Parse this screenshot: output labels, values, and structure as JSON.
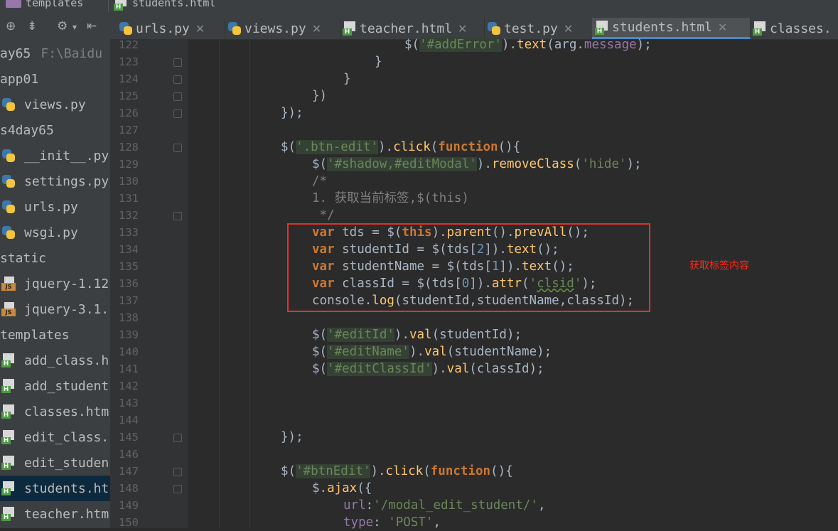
{
  "nav": {
    "folder": "templates",
    "file": "students.html"
  },
  "sidebar": {
    "toolbar": [
      "target",
      "collapse",
      "settings",
      "hide"
    ],
    "items": [
      {
        "label": "ay65",
        "hint": "F:\\Baidu",
        "icon": "none",
        "indent": 0
      },
      {
        "label": "app01",
        "hint": "",
        "icon": "none",
        "indent": 0
      },
      {
        "label": "views.py",
        "hint": "",
        "icon": "python",
        "indent": 1
      },
      {
        "label": "s4day65",
        "hint": "",
        "icon": "none",
        "indent": 0
      },
      {
        "label": "__init__.py",
        "hint": "",
        "icon": "python",
        "indent": 1
      },
      {
        "label": "settings.py",
        "hint": "",
        "icon": "python",
        "indent": 1
      },
      {
        "label": "urls.py",
        "hint": "",
        "icon": "python",
        "indent": 1
      },
      {
        "label": "wsgi.py",
        "hint": "",
        "icon": "python",
        "indent": 1
      },
      {
        "label": "static",
        "hint": "",
        "icon": "none",
        "indent": 0
      },
      {
        "label": "jquery-1.12",
        "hint": "",
        "icon": "js",
        "indent": 1
      },
      {
        "label": "jquery-3.1.",
        "hint": "",
        "icon": "js",
        "indent": 1
      },
      {
        "label": "templates",
        "hint": "",
        "icon": "none",
        "indent": 0
      },
      {
        "label": "add_class.h",
        "hint": "",
        "icon": "html",
        "indent": 1
      },
      {
        "label": "add_student",
        "hint": "",
        "icon": "html",
        "indent": 1
      },
      {
        "label": "classes.htm",
        "hint": "",
        "icon": "html",
        "indent": 1
      },
      {
        "label": "edit_class.",
        "hint": "",
        "icon": "html",
        "indent": 1
      },
      {
        "label": "edit_studen",
        "hint": "",
        "icon": "html",
        "indent": 1
      },
      {
        "label": "students.ht",
        "hint": "",
        "icon": "html",
        "indent": 1,
        "selected": true
      },
      {
        "label": "teacher.htm",
        "hint": "",
        "icon": "html",
        "indent": 1
      }
    ]
  },
  "tabs": [
    {
      "label": "urls.py",
      "icon": "python",
      "active": false
    },
    {
      "label": "views.py",
      "icon": "python",
      "active": false
    },
    {
      "label": "teacher.html",
      "icon": "html",
      "active": false
    },
    {
      "label": "test.py",
      "icon": "python",
      "active": false
    },
    {
      "label": "students.html",
      "icon": "html",
      "active": true
    },
    {
      "label": "classes.",
      "icon": "html",
      "active": false
    }
  ],
  "line_numbers": [
    "122",
    "123",
    "124",
    "125",
    "126",
    "127",
    "128",
    "129",
    "130",
    "131",
    "132",
    "133",
    "134",
    "135",
    "136",
    "137",
    "138",
    "139",
    "140",
    "141",
    "142",
    "143",
    "144",
    "145",
    "146",
    "147",
    "148",
    "149",
    "150"
  ],
  "code": {
    "l122_a": "$(",
    "l122_b": "'#addError'",
    "l122_c": ").",
    "l122_d": "text",
    "l122_e": "(arg.",
    "l122_f": "message",
    "l122_g": ");",
    "l123": "}",
    "l124": "}",
    "l125": "})",
    "l126": "});",
    "l128_a": "$(",
    "l128_b": "'.btn-edit'",
    "l128_c": ").",
    "l128_d": "click",
    "l128_e": "(",
    "l128_f": "function",
    "l128_g": "(){",
    "l129_a": "$(",
    "l129_b": "'#shadow,#editModal'",
    "l129_c": ").",
    "l129_d": "removeClass",
    "l129_e": "(",
    "l129_f": "'hide'",
    "l129_g": ");",
    "l130": "/*",
    "l131": "1. 获取当前标签,$(this)",
    "l132": " */",
    "l133_a": "var",
    "l133_b": " tds = $(",
    "l133_c": "this",
    "l133_d": ").",
    "l133_e": "parent",
    "l133_f": "().",
    "l133_g": "prevAll",
    "l133_h": "();",
    "l134_a": "var",
    "l134_b": " studentId = $(tds[",
    "l134_c": "2",
    "l134_d": "]).",
    "l134_e": "text",
    "l134_f": "();",
    "l135_a": "var",
    "l135_b": " studentName = $(tds[",
    "l135_c": "1",
    "l135_d": "]).",
    "l135_e": "text",
    "l135_f": "();",
    "l136_a": "var",
    "l136_b": " classId = $(tds[",
    "l136_c": "0",
    "l136_d": "]).",
    "l136_e": "attr",
    "l136_f": "(",
    "l136_g": "'",
    "l136_h": "clsid",
    "l136_i": "'",
    "l136_j": ");",
    "l137_a": "console.",
    "l137_b": "log",
    "l137_c": "(studentId,studentName,classId);",
    "l139_a": "$(",
    "l139_b": "'#editId'",
    "l139_c": ").",
    "l139_d": "val",
    "l139_e": "(studentId);",
    "l140_a": "$(",
    "l140_b": "'#editName'",
    "l140_c": ").",
    "l140_d": "val",
    "l140_e": "(studentName);",
    "l141_a": "$(",
    "l141_b": "'#editClassId'",
    "l141_c": ").",
    "l141_d": "val",
    "l141_e": "(classId);",
    "l145": "});",
    "l147_a": "$(",
    "l147_b": "'#btnEdit'",
    "l147_c": ").",
    "l147_d": "click",
    "l147_e": "(",
    "l147_f": "function",
    "l147_g": "(){",
    "l148_a": "$.",
    "l148_b": "ajax",
    "l148_c": "({",
    "l149_a": "url",
    "l149_b": ":",
    "l149_c": "'/modal_edit_student/'",
    "l149_d": ",",
    "l150_a": "type",
    "l150_b": ": ",
    "l150_c": "'POST'",
    "l150_d": ","
  },
  "annotation": "获取标签内容",
  "colors": {
    "background": "#2b2b2b",
    "keyword": "#cc7832",
    "string": "#6a8759",
    "function": "#ffc66d",
    "property": "#9876aa",
    "comment": "#808080",
    "highlight_box": "#e2312c"
  }
}
